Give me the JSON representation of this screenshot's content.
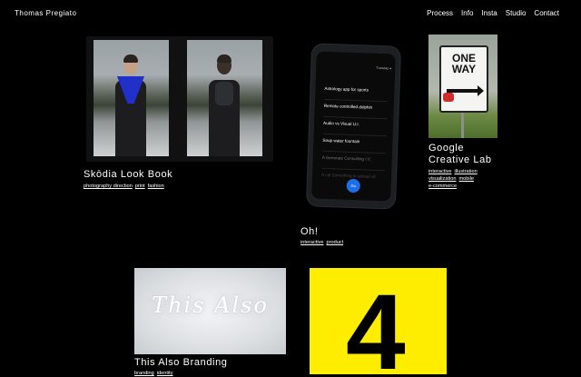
{
  "brand": "Thomas Pregiato",
  "nav": {
    "items": [
      "Process",
      "Info",
      "Insta",
      "Studio",
      "Contact"
    ]
  },
  "projects": {
    "skodia": {
      "title": "Skōdia Look Book",
      "tags": [
        "photography direction",
        "print",
        "fashion"
      ]
    },
    "oh": {
      "title": "Oh!",
      "tags": [
        "interactive",
        "product"
      ],
      "screen": {
        "status": "Tuesday ●",
        "items": [
          "Astrology app for sports",
          "Remote controlled dolphin",
          "Audio vs Visual U.I.",
          "Soup water fountain",
          "A Generate Consulting I.V.",
          "A cat Something to upload all"
        ],
        "button_label": "Go"
      }
    },
    "google": {
      "title_line1": "Google",
      "title_line2": "Creative Lab",
      "tags_line1": [
        "interactive",
        "illustration"
      ],
      "tags_line2": [
        "visualization",
        "mobile"
      ],
      "tags_line3": [
        "e-commerce"
      ],
      "sign_line1": "ONE",
      "sign_line2": "WAY"
    },
    "this_also": {
      "title": "This Also Branding",
      "neon_text": "This Also",
      "tags": [
        "branding",
        "identity"
      ]
    },
    "four": {
      "numeral": "4"
    }
  },
  "colors": {
    "background": "#000000",
    "text": "#ffffff",
    "accent_blue": "#1c6fe8",
    "yellow": "#ffed00"
  }
}
